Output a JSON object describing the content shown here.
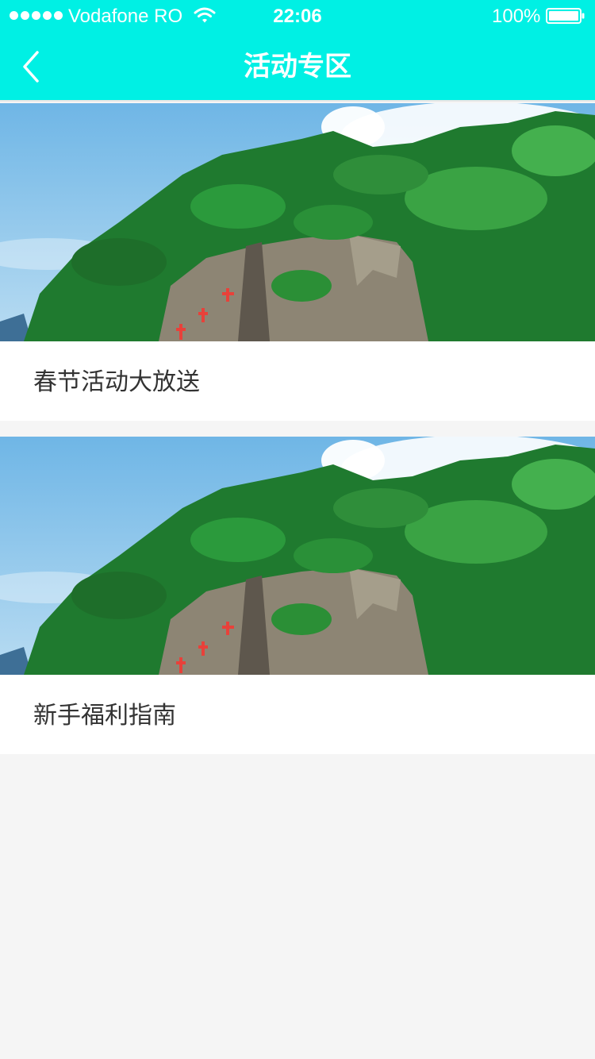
{
  "status_bar": {
    "carrier": "Vodafone RO",
    "time": "22:06",
    "battery": "100%",
    "icons": [
      "signal-dots-icon",
      "wifi-icon",
      "battery-icon"
    ]
  },
  "nav": {
    "title": "活动专区",
    "back_icon": "chevron-left-icon"
  },
  "activities": [
    {
      "title": "春节活动大放送",
      "image": "mountain-cliff-banner"
    },
    {
      "title": "新手福利指南",
      "image": "mountain-cliff-banner"
    }
  ],
  "colors": {
    "header": "#00f0e4",
    "background": "#f5f5f5",
    "card": "#ffffff",
    "text": "#333333"
  }
}
